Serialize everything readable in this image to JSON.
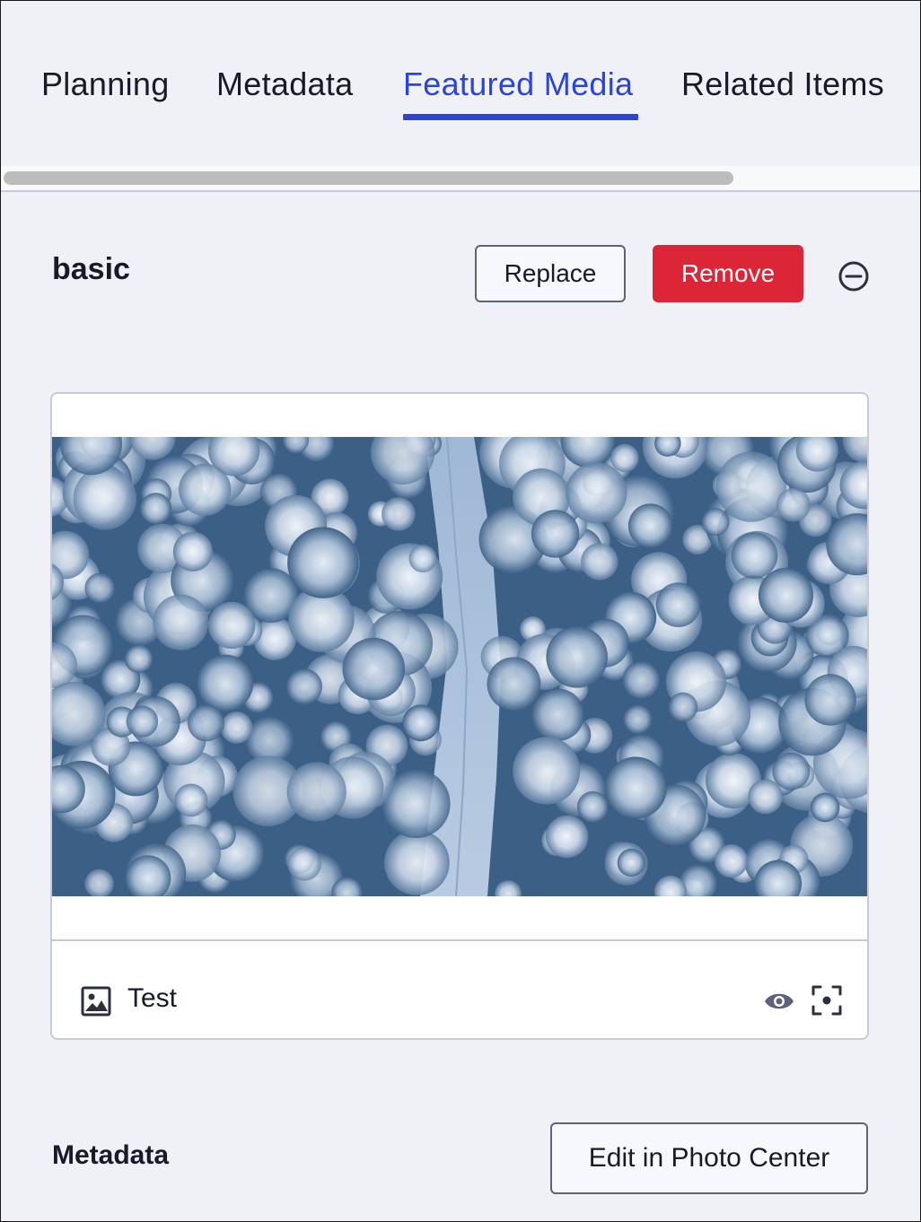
{
  "tabs": [
    {
      "label": "Planning",
      "active": false
    },
    {
      "label": "Metadata",
      "active": false
    },
    {
      "label": "Featured Media",
      "active": true
    },
    {
      "label": "Related Items",
      "active": false
    }
  ],
  "section": {
    "title": "basic",
    "replace_label": "Replace",
    "remove_label": "Remove",
    "collapse_icon": "minus-circle-icon"
  },
  "media_card": {
    "image_type_icon": "image-icon",
    "caption": "Test",
    "preview_icon": "eye-icon",
    "focal_point_icon": "focal-point-icon"
  },
  "metadata": {
    "title": "Metadata",
    "edit_label": "Edit in Photo Center"
  },
  "colors": {
    "accent": "#2a45d8",
    "danger": "#dc2637",
    "background": "#eff1f6"
  }
}
